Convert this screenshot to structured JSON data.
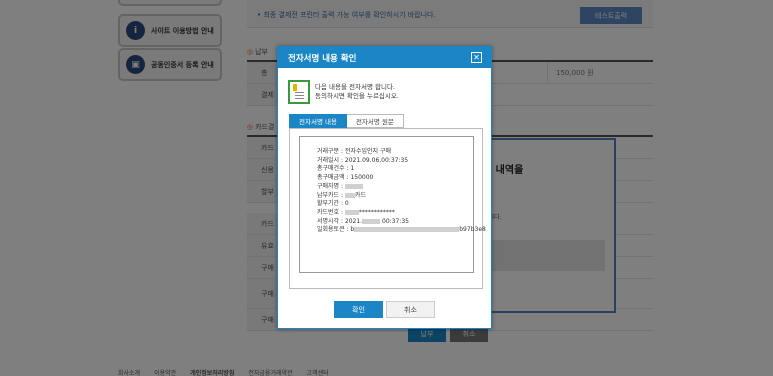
{
  "background": {
    "sidebar": {
      "items": [
        {
          "label": "사이트 이용방법 안내",
          "icon": "info-icon"
        },
        {
          "label": "공동인증서 등록 안내",
          "icon": "certificate-icon"
        }
      ]
    },
    "notice": {
      "text": "최종 결제전 프린터 출력 가능 여부를 확인하시기 바랍니다.",
      "test_button": "테스트출력"
    },
    "section1": {
      "title": "납부",
      "rows": [
        {
          "label": "총",
          "value": "",
          "right": "150,000 원"
        },
        {
          "label": "결제",
          "value": "",
          "right": ""
        }
      ]
    },
    "section2": {
      "title": "카드결",
      "rows": [
        "카드",
        "신용",
        "할부",
        "카드",
        "유효",
        "구매",
        "구매 주민",
        "구매"
      ]
    },
    "inner_panel": {
      "title": "신 내역을",
      "text": "습니다."
    },
    "bottom_buttons": [
      "납부",
      "취소"
    ],
    "footer_links": [
      "회사소개",
      "이용약관",
      "개인정보처리방침",
      "전자금융거래약관",
      "고객센터"
    ]
  },
  "modal": {
    "title": "전자서명 내용 확인",
    "intro_line1": "다음 내용을 전자서명 합니다.",
    "intro_line2": "동의하시면 확인을 누르십시오.",
    "tabs": [
      {
        "label": "전자서명 내용",
        "active": true
      },
      {
        "label": "전자서명 원문",
        "active": false
      }
    ],
    "details": {
      "trade_type": "거래구분 : 전자수입인지 구매",
      "trade_date": "거래일시 : 2021.09.06,00:37:35",
      "total_count": "총구매건수 : 1",
      "total_amount": "총구매금액 : 150000",
      "buyer_prefix": "구매자명 : ",
      "payment_prefix": "납부카드 : ",
      "payment_suffix": "카드",
      "installment": "할부기간 : 0",
      "card_prefix": "카드번호 : ",
      "card_suffix": "************",
      "sign_time_prefix": "서명시각 : 2021.",
      "sign_time_suffix": " 00:37:35",
      "token_prefix": "일회용토큰 : b",
      "token_suffix": "b97b3e8"
    },
    "confirm_label": "확인",
    "cancel_label": "취소"
  },
  "colors": {
    "primary": "#1b86c6",
    "overlay": "#000000"
  }
}
